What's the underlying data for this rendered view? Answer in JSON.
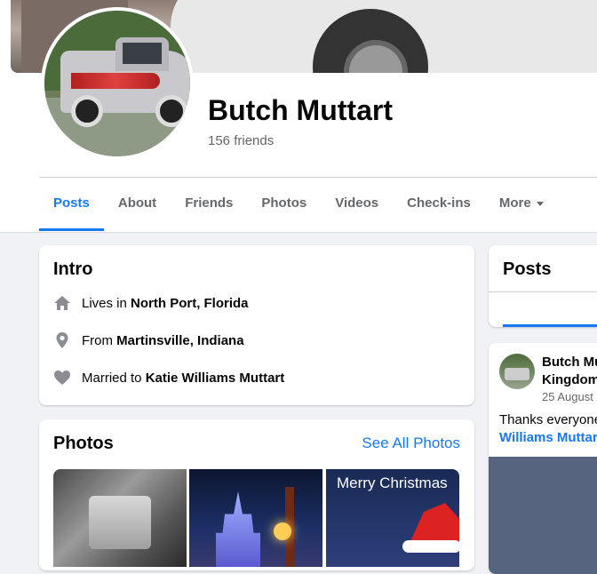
{
  "profile": {
    "name": "Butch Muttart",
    "friends": "156 friends"
  },
  "tabs": [
    "Posts",
    "About",
    "Friends",
    "Photos",
    "Videos",
    "Check-ins",
    "More"
  ],
  "intro": {
    "title": "Intro",
    "lives_prefix": "Lives in",
    "lives_place": "North Port, Florida",
    "from_prefix": "From",
    "from_place": "Martinsville, Indiana",
    "married_prefix": "Married to",
    "married_name": "Katie Williams Muttart"
  },
  "photos": {
    "title": "Photos",
    "see_all": "See All Photos",
    "photo3_text": "Merry Christmas"
  },
  "posts": {
    "title": "Posts",
    "author_line1": "Butch Mu",
    "author_line2": "Kingdom",
    "date": "25 August",
    "text": "Thanks everyone",
    "link": "Williams Muttar"
  },
  "colors": {
    "accent": "#1877f2",
    "secondary_text": "#65676b",
    "background": "#f0f2f5"
  }
}
